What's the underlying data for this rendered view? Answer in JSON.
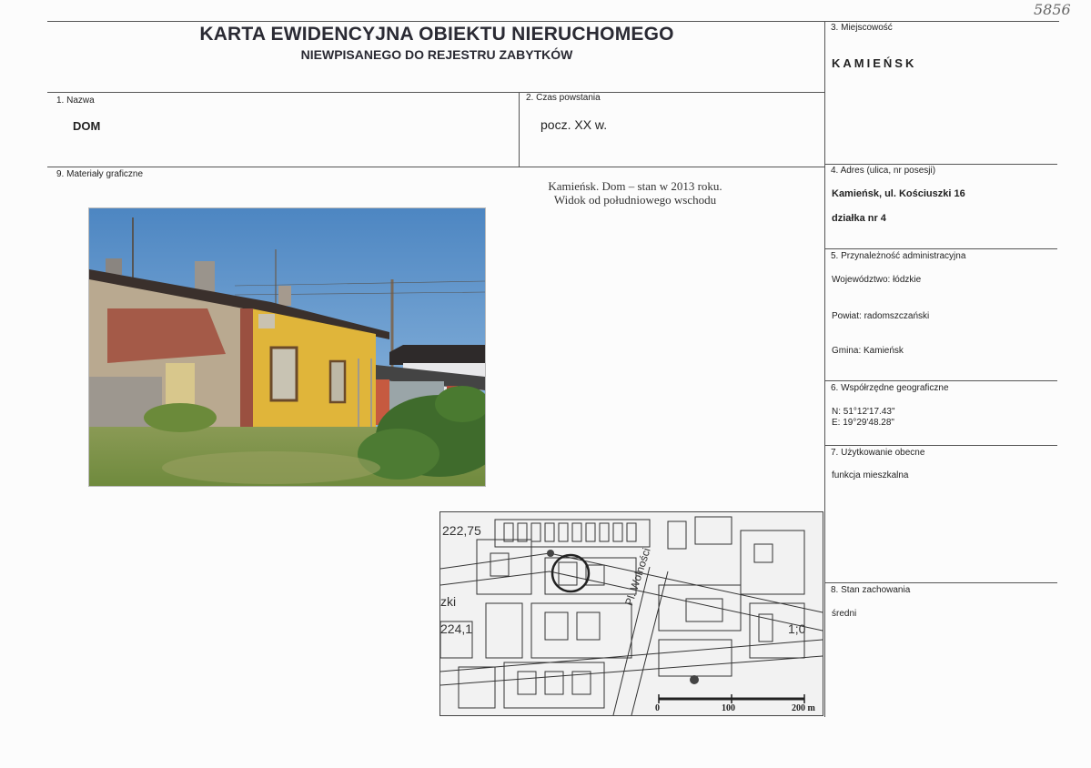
{
  "archive_number": "5856",
  "header": {
    "title": "KARTA EWIDENCYJNA OBIEKTU NIERUCHOMEGO",
    "subtitle": "NIEWPISANEGO DO REJESTRU ZABYTKÓW"
  },
  "fields": {
    "name": {
      "label": "1. Nazwa",
      "value": "DOM"
    },
    "date": {
      "label": "2. Czas powstania",
      "value": "pocz. XX w."
    },
    "place": {
      "label": "3. Miejscowość",
      "value": "KAMIEŃSK"
    },
    "address": {
      "label": "4. Adres (ulica, nr posesji)",
      "line1": "Kamieńsk, ul. Kościuszki 16",
      "line2": "działka nr 4"
    },
    "admin": {
      "label": "5. Przynależność administracyjna",
      "voivodeship": "Województwo: łódzkie",
      "county": "Powiat: radomszczański",
      "commune": "Gmina: Kamieńsk"
    },
    "coords": {
      "label": "6. Współrzędne geograficzne",
      "n": "N: 51°12'17.43\"",
      "e": "E: 19°29'48.28\""
    },
    "usage": {
      "label": "7. Użytkowanie obecne",
      "value": "funkcja mieszkalna"
    },
    "condition": {
      "label": "8. Stan zachowania",
      "value": "średni"
    },
    "graphics": {
      "label": "9. Materiały graficzne"
    }
  },
  "photo_caption": {
    "line1": "Kamieńsk. Dom – stan w 2013 roku.",
    "line2": "Widok od południowego wschodu"
  },
  "map": {
    "labels": [
      "222,75",
      "zki",
      "224,1",
      "Pl. Wolności",
      "1;0"
    ],
    "scale": [
      "0",
      "100",
      "200 m"
    ]
  },
  "colors": {
    "line": "#555555",
    "text": "#222222",
    "house_yellow": "#e0b53a",
    "sky": "#5b8fc6"
  }
}
